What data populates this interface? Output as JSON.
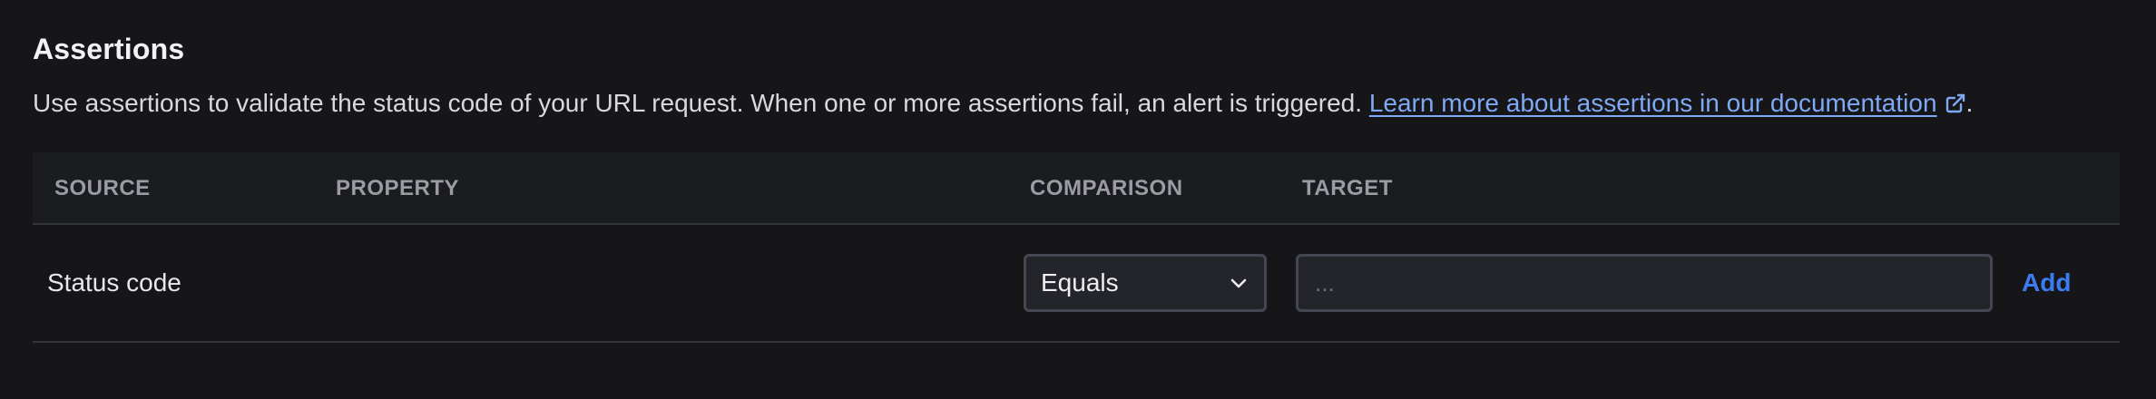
{
  "assertions": {
    "title": "Assertions",
    "description": "Use assertions to validate the status code of your URL request. When one or more assertions fail, an alert is triggered.",
    "doc_link_label": "Learn more about assertions in our documentation",
    "link_icon": "external-link-icon",
    "trailing_period": "."
  },
  "table": {
    "headers": {
      "source": "SOURCE",
      "property": "PROPERTY",
      "comparison": "COMPARISON",
      "target": "TARGET"
    },
    "row": {
      "source": "Status code",
      "property": "",
      "comparison_value": "Equals",
      "comparison_icon": "chevron-down-icon",
      "target_value": "",
      "target_placeholder": "...",
      "add_label": "Add"
    }
  },
  "colors": {
    "background": "#161619",
    "header_background": "#1b1c20",
    "link": "#7fa8f5",
    "accent": "#3b7df0"
  }
}
